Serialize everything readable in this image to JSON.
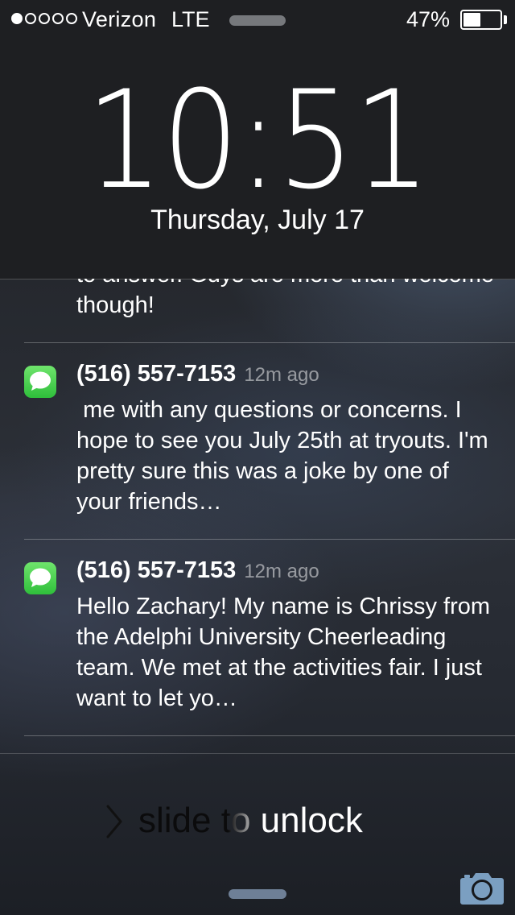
{
  "status_bar": {
    "signal_bars_filled": 1,
    "signal_bars_total": 5,
    "carrier": "Verizon",
    "network": "LTE",
    "battery_percent_label": "47%",
    "battery_level": 0.47
  },
  "lock_screen": {
    "time": "10:51",
    "date": "Thursday, July 17"
  },
  "notifications": {
    "partial_top_text": "to answer. Guys are more than welcome though!",
    "items": [
      {
        "app_icon": "messages-icon",
        "sender": "(516) 557-7153",
        "time_ago": "12m ago",
        "body": " me with any questions or concerns. I hope to see you July 25th at tryouts. I'm pretty sure this was a joke by one of your friends…"
      },
      {
        "app_icon": "messages-icon",
        "sender": "(516) 557-7153",
        "time_ago": "12m ago",
        "body": "Hello Zachary! My name is Chrissy from the Adelphi University Cheerleading team. We met at the activities fair. I just want to let yo…"
      }
    ]
  },
  "unlock": {
    "label": "slide to unlock"
  },
  "icons": {
    "chevron": "chevron-right-icon",
    "camera": "camera-icon"
  },
  "colors": {
    "messages_green": "#4cd964",
    "top_panel": "#1e1f22"
  }
}
